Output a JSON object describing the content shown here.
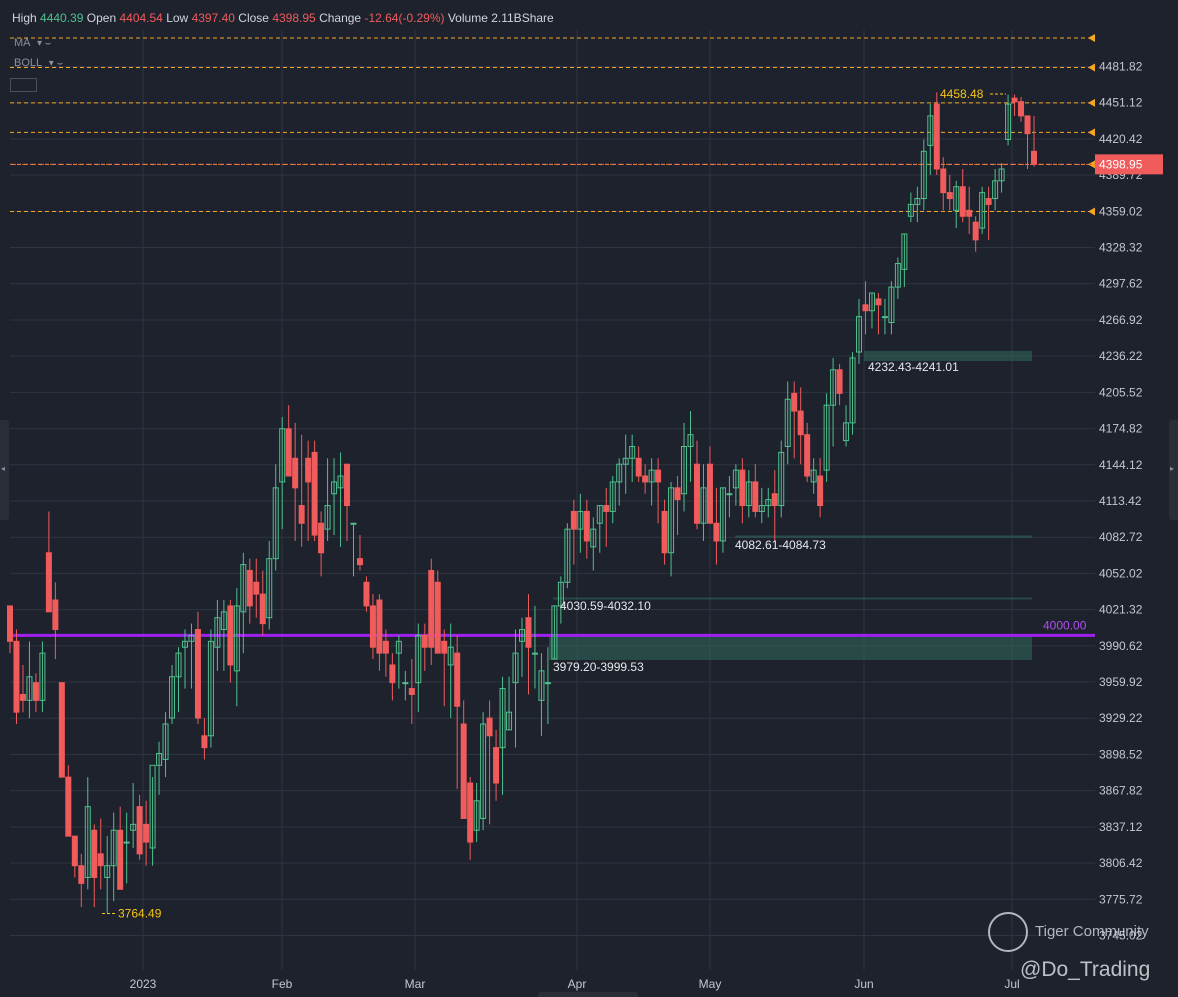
{
  "header": {
    "high_label": "High",
    "high": "4440.39",
    "open_label": "Open",
    "open": "4404.54",
    "low_label": "Low",
    "low": "4397.40",
    "close_label": "Close",
    "close": "4398.95",
    "change_label": "Change",
    "change": "-12.64(-0.29%)",
    "volume_label": "Volume",
    "volume": "2.11BShare"
  },
  "indicators": {
    "ma": "MA",
    "boll": "BOLL"
  },
  "watermark": {
    "brand": "Tiger Community",
    "handle": "@Do_Trading"
  },
  "colors": {
    "up": "#4fc08d",
    "down": "#f05b5b",
    "support_line": "#a020f0",
    "level_line": "#f5a623",
    "zone": "#2f6b5c",
    "background": "#1e222d",
    "grid": "#2f3441"
  },
  "chart_data": {
    "type": "candlestick",
    "title": "",
    "price_range": [
      3745.02,
      4481.82
    ],
    "y_ticks": [
      "4481.82",
      "4451.12",
      "4420.42",
      "4389.72",
      "4359.02",
      "4328.32",
      "4297.62",
      "4266.92",
      "4236.22",
      "4205.52",
      "4174.82",
      "4144.12",
      "4113.42",
      "4082.72",
      "4052.02",
      "4021.32",
      "3990.62",
      "3959.92",
      "3929.22",
      "3898.52",
      "3867.82",
      "3837.12",
      "3806.42",
      "3775.72",
      "3745.02"
    ],
    "x_ticks": [
      "2023",
      "Feb",
      "Mar",
      "Apr",
      "May",
      "Jun",
      "Jul"
    ],
    "last_price": "4398.95",
    "period_high": "4458.48",
    "period_low": "3764.49",
    "horizontal_levels": [
      4506,
      4481,
      4451,
      4426,
      4398.95,
      4359
    ],
    "support_line": {
      "value": 4000,
      "label": "4000.00"
    },
    "zones": [
      {
        "label": "4232.43-4241.01",
        "low": 4232.43,
        "high": 4241.01
      },
      {
        "label": "4082.61-4084.73",
        "low": 4082.61,
        "high": 4084.73
      },
      {
        "label": "4030.59-4032.10",
        "low": 4030.59,
        "high": 4032.1
      },
      {
        "label": "3979.20-3999.53",
        "low": 3979.2,
        "high": 3999.53
      }
    ],
    "candles": [
      [
        4025,
        4025,
        3985,
        3995
      ],
      [
        3995,
        4005,
        3925,
        3935
      ],
      [
        3950,
        3975,
        3935,
        3945
      ],
      [
        3945,
        3995,
        3930,
        3965
      ],
      [
        3960,
        3968,
        3935,
        3945
      ],
      [
        3945,
        3995,
        3935,
        3985
      ],
      [
        4070,
        4105,
        4020,
        4020
      ],
      [
        4030,
        4045,
        3980,
        4005
      ],
      [
        3960,
        3960,
        3880,
        3880
      ],
      [
        3880,
        3890,
        3830,
        3830
      ],
      [
        3830,
        3830,
        3795,
        3805
      ],
      [
        3805,
        3815,
        3770,
        3790
      ],
      [
        3795,
        3880,
        3785,
        3855
      ],
      [
        3835,
        3840,
        3770,
        3795
      ],
      [
        3815,
        3845,
        3785,
        3805
      ],
      [
        3795,
        3830,
        3765,
        3805
      ],
      [
        3805,
        3850,
        3775,
        3835
      ],
      [
        3835,
        3855,
        3785,
        3785
      ],
      [
        3825,
        3850,
        3790,
        3825
      ],
      [
        3835,
        3875,
        3820,
        3840
      ],
      [
        3855,
        3865,
        3810,
        3815
      ],
      [
        3840,
        3860,
        3805,
        3825
      ],
      [
        3820,
        3880,
        3805,
        3890
      ],
      [
        3890,
        3910,
        3865,
        3900
      ],
      [
        3895,
        3935,
        3880,
        3925
      ],
      [
        3930,
        3975,
        3925,
        3965
      ],
      [
        3965,
        3990,
        3935,
        3985
      ],
      [
        3990,
        4005,
        3955,
        3995
      ],
      [
        3995,
        4010,
        3955,
        4000
      ],
      [
        4005,
        4020,
        3925,
        3930
      ],
      [
        3915,
        3930,
        3895,
        3905
      ],
      [
        3915,
        4005,
        3905,
        3995
      ],
      [
        3990,
        4030,
        3970,
        4015
      ],
      [
        4005,
        4030,
        3970,
        4020
      ],
      [
        4025,
        4030,
        3960,
        3975
      ],
      [
        3970,
        4040,
        3940,
        4025
      ],
      [
        4020,
        4070,
        3985,
        4060
      ],
      [
        4055,
        4065,
        4010,
        4025
      ],
      [
        4045,
        4065,
        4015,
        4035
      ],
      [
        4035,
        4055,
        4000,
        4010
      ],
      [
        4015,
        4080,
        4005,
        4065
      ],
      [
        4065,
        4145,
        4055,
        4125
      ],
      [
        4130,
        4185,
        4090,
        4175
      ],
      [
        4175,
        4195,
        4145,
        4135
      ],
      [
        4150,
        4180,
        4080,
        4125
      ],
      [
        4110,
        4170,
        4075,
        4095
      ],
      [
        4150,
        4165,
        4080,
        4130
      ],
      [
        4155,
        4165,
        4080,
        4085
      ],
      [
        4095,
        4105,
        4050,
        4070
      ],
      [
        4090,
        4150,
        4080,
        4110
      ],
      [
        4120,
        4150,
        4085,
        4130
      ],
      [
        4125,
        4155,
        4075,
        4135
      ],
      [
        4145,
        4145,
        4080,
        4110
      ],
      [
        4095,
        4095,
        4050,
        4095
      ],
      [
        4065,
        4085,
        4055,
        4060
      ],
      [
        4045,
        4050,
        4020,
        4025
      ],
      [
        4025,
        4035,
        3980,
        3990
      ],
      [
        4030,
        4035,
        3970,
        3985
      ],
      [
        3995,
        4005,
        3965,
        3985
      ],
      [
        3975,
        3985,
        3945,
        3960
      ],
      [
        3985,
        4000,
        3955,
        3995
      ],
      [
        3960,
        3970,
        3945,
        3960
      ],
      [
        3955,
        3980,
        3925,
        3950
      ],
      [
        3960,
        4010,
        3935,
        4000
      ],
      [
        4000,
        4010,
        3970,
        3990
      ],
      [
        4055,
        4065,
        3975,
        3990
      ],
      [
        4045,
        4055,
        3985,
        3985
      ],
      [
        3995,
        4005,
        3940,
        3985
      ],
      [
        3975,
        4010,
        3930,
        3990
      ],
      [
        3985,
        4000,
        3870,
        3940
      ],
      [
        3925,
        3945,
        3845,
        3845
      ],
      [
        3875,
        3880,
        3810,
        3825
      ],
      [
        3835,
        3875,
        3825,
        3860
      ],
      [
        3845,
        3935,
        3835,
        3925
      ],
      [
        3930,
        3945,
        3840,
        3915
      ],
      [
        3905,
        3920,
        3860,
        3875
      ],
      [
        3905,
        3965,
        3865,
        3955
      ],
      [
        3920,
        3965,
        3920,
        3935
      ],
      [
        3960,
        4005,
        3905,
        3985
      ],
      [
        3995,
        4015,
        3965,
        4005
      ],
      [
        4015,
        4035,
        3950,
        3990
      ],
      [
        3985,
        4025,
        3955,
        3985
      ],
      [
        3945,
        3985,
        3915,
        3970
      ],
      [
        3960,
        3990,
        3925,
        3960
      ],
      [
        3980,
        4025,
        3980,
        4025
      ],
      [
        4025,
        4050,
        4010,
        4045
      ],
      [
        4045,
        4095,
        4040,
        4090
      ],
      [
        4105,
        4115,
        4060,
        4090
      ],
      [
        4090,
        4120,
        4070,
        4105
      ],
      [
        4105,
        4115,
        4065,
        4080
      ],
      [
        4075,
        4100,
        4055,
        4090
      ],
      [
        4095,
        4110,
        4070,
        4110
      ],
      [
        4110,
        4125,
        4075,
        4105
      ],
      [
        4105,
        4135,
        4095,
        4130
      ],
      [
        4130,
        4150,
        4110,
        4145
      ],
      [
        4145,
        4170,
        4120,
        4150
      ],
      [
        4150,
        4170,
        4130,
        4160
      ],
      [
        4150,
        4160,
        4130,
        4135
      ],
      [
        4135,
        4145,
        4120,
        4130
      ],
      [
        4130,
        4150,
        4110,
        4140
      ],
      [
        4140,
        4150,
        4095,
        4130
      ],
      [
        4105,
        4115,
        4060,
        4070
      ],
      [
        4070,
        4130,
        4050,
        4125
      ],
      [
        4125,
        4135,
        4085,
        4115
      ],
      [
        4120,
        4180,
        4105,
        4160
      ],
      [
        4160,
        4190,
        4130,
        4170
      ],
      [
        4145,
        4165,
        4090,
        4095
      ],
      [
        4095,
        4145,
        4080,
        4125
      ],
      [
        4145,
        4160,
        4095,
        4095
      ],
      [
        4095,
        4125,
        4060,
        4080
      ],
      [
        4080,
        4125,
        4070,
        4125
      ],
      [
        4120,
        4135,
        4100,
        4120
      ],
      [
        4125,
        4145,
        4110,
        4140
      ],
      [
        4140,
        4150,
        4095,
        4110
      ],
      [
        4110,
        4140,
        4100,
        4130
      ],
      [
        4130,
        4145,
        4100,
        4105
      ],
      [
        4105,
        4125,
        4095,
        4110
      ],
      [
        4110,
        4125,
        4100,
        4115
      ],
      [
        4120,
        4140,
        4080,
        4110
      ],
      [
        4110,
        4165,
        4100,
        4155
      ],
      [
        4160,
        4215,
        4145,
        4200
      ],
      [
        4205,
        4215,
        4150,
        4190
      ],
      [
        4190,
        4210,
        4145,
        4170
      ],
      [
        4170,
        4180,
        4130,
        4135
      ],
      [
        4130,
        4150,
        4120,
        4140
      ],
      [
        4135,
        4150,
        4100,
        4110
      ],
      [
        4140,
        4205,
        4130,
        4195
      ],
      [
        4195,
        4235,
        4160,
        4225
      ],
      [
        4225,
        4230,
        4195,
        4205
      ],
      [
        4165,
        4195,
        4160,
        4180
      ],
      [
        4180,
        4240,
        4170,
        4235
      ],
      [
        4240,
        4285,
        4230,
        4270
      ],
      [
        4280,
        4300,
        4255,
        4275
      ],
      [
        4275,
        4290,
        4260,
        4290
      ],
      [
        4285,
        4290,
        4255,
        4280
      ],
      [
        4270,
        4285,
        4255,
        4270
      ],
      [
        4265,
        4300,
        4255,
        4295
      ],
      [
        4295,
        4320,
        4285,
        4315
      ],
      [
        4310,
        4340,
        4295,
        4340
      ],
      [
        4355,
        4375,
        4350,
        4365
      ],
      [
        4365,
        4380,
        4350,
        4370
      ],
      [
        4370,
        4420,
        4360,
        4410
      ],
      [
        4415,
        4450,
        4390,
        4440
      ],
      [
        4450,
        4460,
        4390,
        4395
      ],
      [
        4395,
        4405,
        4360,
        4375
      ],
      [
        4375,
        4390,
        4360,
        4370
      ],
      [
        4360,
        4385,
        4345,
        4380
      ],
      [
        4380,
        4395,
        4350,
        4355
      ],
      [
        4360,
        4380,
        4340,
        4355
      ],
      [
        4350,
        4355,
        4325,
        4335
      ],
      [
        4345,
        4380,
        4340,
        4375
      ],
      [
        4370,
        4380,
        4335,
        4365
      ],
      [
        4370,
        4395,
        4360,
        4385
      ],
      [
        4385,
        4400,
        4375,
        4395
      ],
      [
        4420,
        4458,
        4415,
        4450
      ],
      [
        4455,
        4458,
        4440,
        4452
      ],
      [
        4452,
        4456,
        4435,
        4440
      ],
      [
        4440,
        4440,
        4395,
        4425
      ],
      [
        4410,
        4440,
        4397,
        4399
      ]
    ],
    "candle_count": 165
  }
}
